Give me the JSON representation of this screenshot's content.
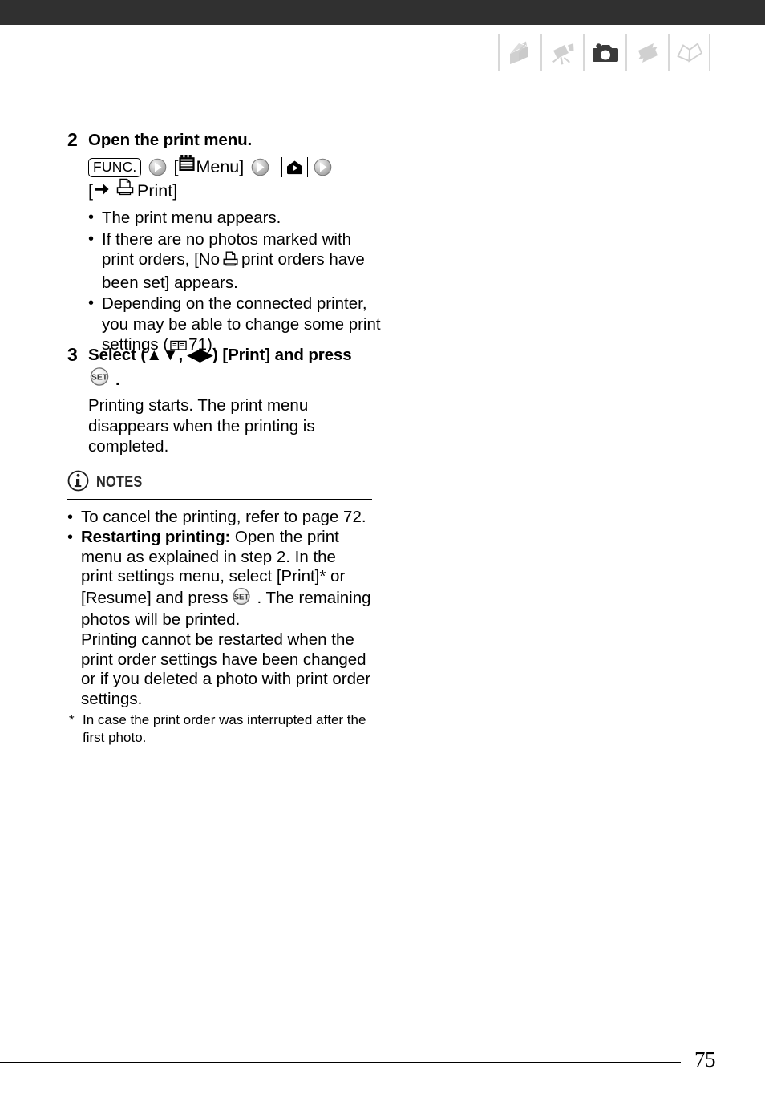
{
  "page": {
    "number": "75",
    "top_bar_color": "#303030"
  },
  "icon_strip": {
    "icons": [
      {
        "name": "intro-box-arrow-icon",
        "label": "Introduction",
        "active": false
      },
      {
        "name": "camcorder-icon",
        "label": "Video",
        "active": false
      },
      {
        "name": "photo-camera-icon",
        "label": "Photos",
        "active": true
      },
      {
        "name": "exchange-arrows-icon",
        "label": "External Connections",
        "active": false
      },
      {
        "name": "open-book-icon",
        "label": "Additional Information",
        "active": false
      }
    ],
    "active_color": "#3b3b3b",
    "inactive_color": "#d0d0d0"
  },
  "steps": [
    {
      "number": "2",
      "title": "Open the print menu.",
      "operation": {
        "func_button": "FUNC.",
        "menu_label": "Menu]",
        "menu_open_bracket": "[",
        "print_line_open": "[",
        "print_label": "Print]"
      },
      "bullets": [
        "The print menu appears.",
        "If there are no photos marked with print orders, [No   print orders have been set] appears.",
        "Depending on the connected printer, you may be able to change some print settings ( 71)."
      ],
      "bullet_parts": {
        "b2_pre": "If there are no photos marked with print orders, [No",
        "b2_post": "print orders have been set] appears.",
        "b3_pre": "Depending on the connected printer, you may be able to change some print settings (",
        "b3_page": "71).",
        "page_ref": "71"
      }
    },
    {
      "number": "3",
      "title_pre": "Select (",
      "title_updown": "▲▼",
      "title_mid": ",",
      "title_leftright": "◀▶",
      "title_post": ") [Print] and press",
      "title_full": "Select (▲▼, ◀▶) [Print] and press",
      "set_suffix": ".",
      "paragraph": "Printing starts. The print menu disappears when the printing is completed."
    }
  ],
  "notes": {
    "heading": "NOTES",
    "info_icon": "i",
    "items": [
      {
        "bold": "",
        "text": "To cancel the printing, refer to page 72."
      },
      {
        "bold": "Restarting printing:",
        "text_pre": " Open the print menu as explained in step 2. In the print settings menu, select [Print]* or [Resume] and press",
        "text_post": ". The remaining photos will be printed."
      }
    ],
    "continuation": "Printing cannot be restarted when the print order settings have been changed or if you deleted a photo with print order settings.",
    "footnote_marker": "*",
    "footnote": "In case the print order was interrupted after the first photo."
  }
}
